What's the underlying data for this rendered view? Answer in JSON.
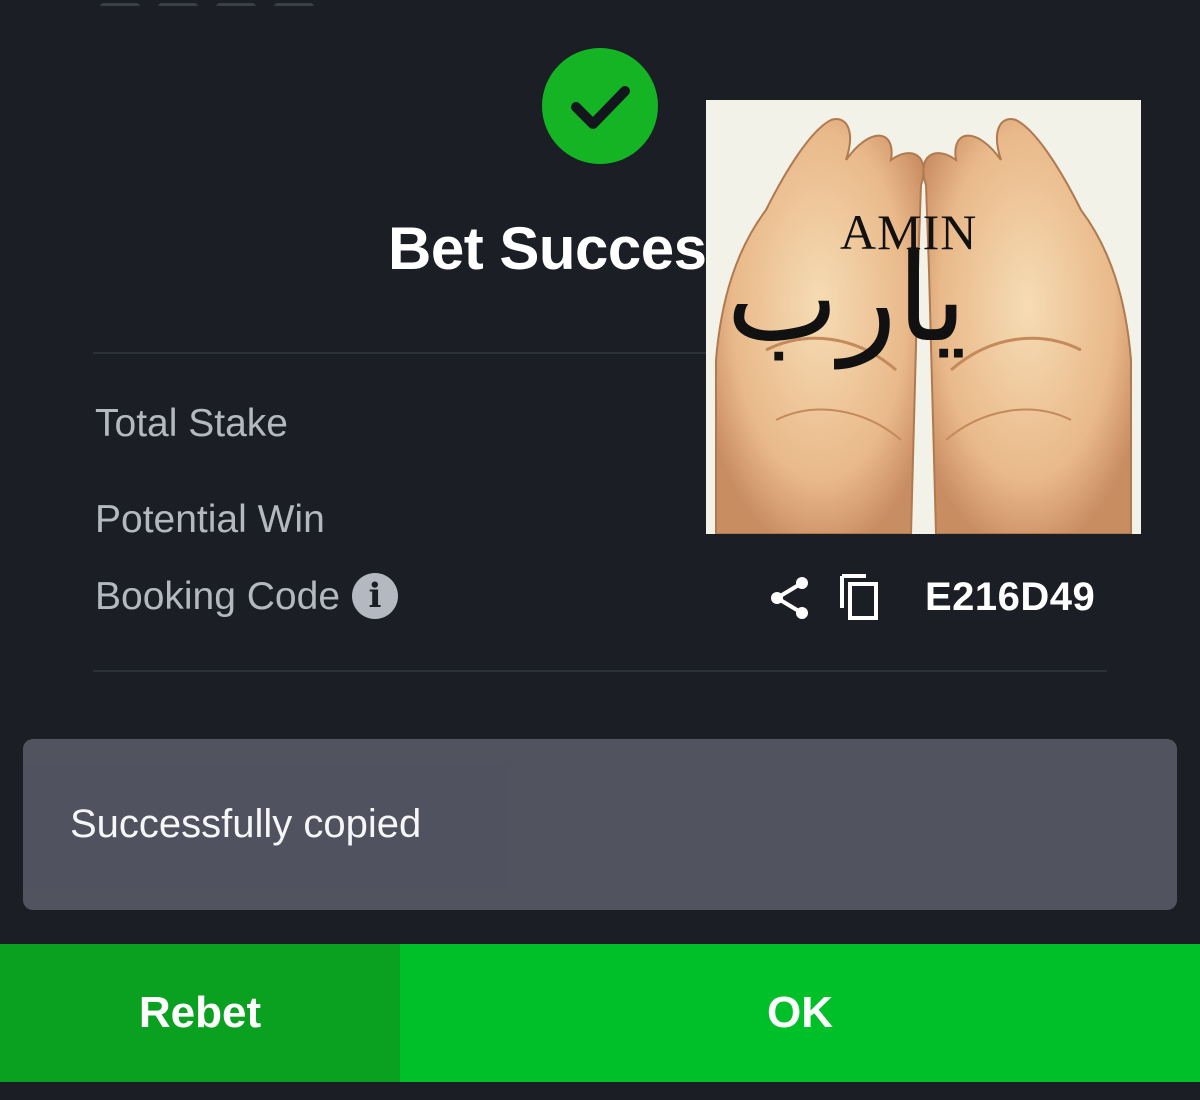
{
  "colors": {
    "background": "#1b1e25",
    "success_green": "#14b424",
    "rebet_green": "#0aa020",
    "ok_green": "#00c02a",
    "toast_bg": "#535662",
    "label_gray": "#b4b8c1"
  },
  "header": {
    "status_icon": "checkmark-icon",
    "title": "Bet Succes"
  },
  "details": {
    "total_stake_label": "Total Stake",
    "potential_win_label": "Potential Win",
    "booking_code_label": "Booking Code",
    "booking_info_icon": "info-icon",
    "share_icon": "share-icon",
    "copy_icon": "copy-icon",
    "booking_code_value": "E216D49"
  },
  "overlay_image": {
    "latin_text": "AMIN",
    "arabic_text": "يارب"
  },
  "toast": {
    "message": "Successfully copied"
  },
  "actions": {
    "rebet_label": "Rebet",
    "ok_label": "OK"
  }
}
